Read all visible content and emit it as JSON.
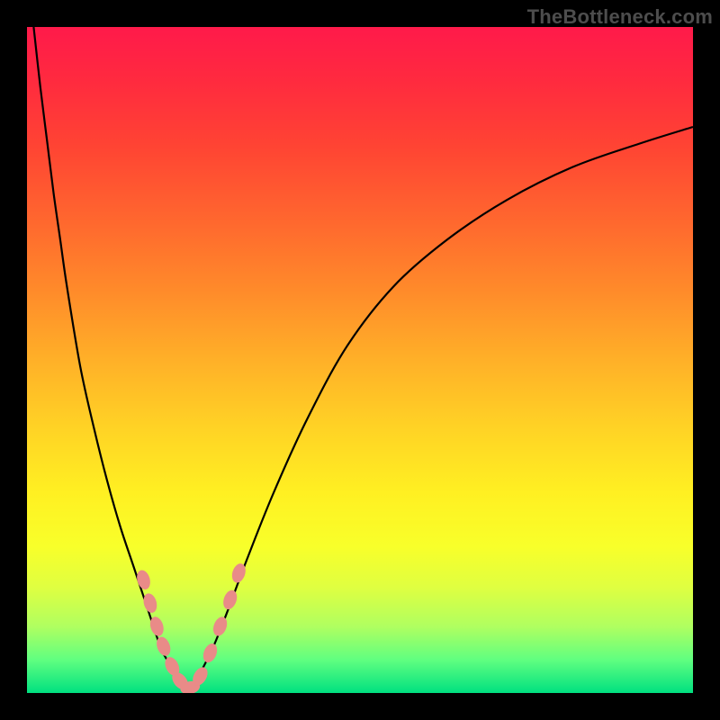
{
  "watermark": "TheBottleneck.com",
  "colors": {
    "background_frame": "#000000",
    "curve_stroke": "#000000",
    "marker_fill": "#e98b88",
    "marker_stroke": "#d87874"
  },
  "chart_data": {
    "type": "line",
    "title": "",
    "xlabel": "",
    "ylabel": "",
    "xlim": [
      0,
      100
    ],
    "ylim": [
      0,
      100
    ],
    "grid": false,
    "series": [
      {
        "name": "left-branch",
        "x": [
          1,
          2,
          3,
          4,
          5,
          6,
          8,
          10,
          12,
          14,
          16,
          18,
          20,
          21,
          22,
          23,
          24
        ],
        "values": [
          100,
          91,
          83,
          75,
          68,
          61,
          49,
          40,
          32,
          25,
          19,
          13,
          7,
          5,
          3,
          1.5,
          0.5
        ]
      },
      {
        "name": "right-branch",
        "x": [
          24,
          25,
          26,
          28,
          30,
          33,
          37,
          42,
          48,
          55,
          63,
          72,
          82,
          92,
          100
        ],
        "values": [
          0.5,
          1.5,
          3,
          7,
          12,
          20,
          30,
          41,
          52,
          61,
          68,
          74,
          79,
          82.5,
          85
        ]
      }
    ],
    "markers": {
      "name": "highlight-cluster",
      "points": [
        {
          "x": 17.5,
          "y": 17
        },
        {
          "x": 18.5,
          "y": 13.5
        },
        {
          "x": 19.5,
          "y": 10
        },
        {
          "x": 20.5,
          "y": 7
        },
        {
          "x": 21.8,
          "y": 4
        },
        {
          "x": 23,
          "y": 1.8
        },
        {
          "x": 24.5,
          "y": 0.8
        },
        {
          "x": 26,
          "y": 2.5
        },
        {
          "x": 27.5,
          "y": 6
        },
        {
          "x": 29,
          "y": 10
        },
        {
          "x": 30.5,
          "y": 14
        },
        {
          "x": 31.8,
          "y": 18
        }
      ],
      "rx": 7,
      "ry": 11,
      "rotate_towards_curve": true
    }
  }
}
